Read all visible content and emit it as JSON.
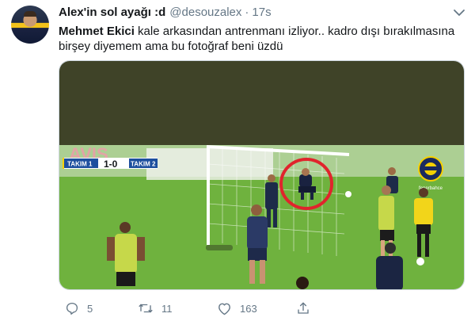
{
  "tweet": {
    "display_name": "Alex'in sol ayağı :d",
    "handle": "@desouzalex",
    "separator": "·",
    "time": "17s",
    "text_bold": "Mehmet Ekici",
    "text_line1_rest": " kale arkasından antrenmanı izliyor.. kadro dışı bırakılmasına",
    "text_line2": "birşey diyemem ama bu fotoğraf beni üzdü"
  },
  "media": {
    "scoreboard": {
      "team1": "TAKIM 1",
      "score": "1-0",
      "team2": "TAKIM 2"
    },
    "background_letters": "AVIS",
    "channel_logo_text": "fenerbahce",
    "colors": {
      "top_bar": "#3f4328",
      "grass": "#6fb23e",
      "highlight_ring": "#e0242c",
      "scoreboard_blue": "#1d4f9e",
      "scoreboard_yellow": "#f5d000"
    }
  },
  "actions": {
    "reply_count": "5",
    "retweet_count": "11",
    "like_count": "163",
    "icons": [
      "reply-icon",
      "retweet-icon",
      "like-icon",
      "share-icon"
    ]
  }
}
